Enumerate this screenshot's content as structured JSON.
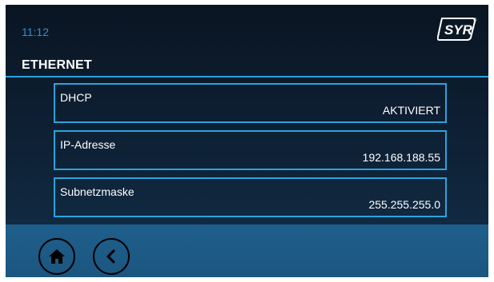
{
  "status": {
    "time": "11:12"
  },
  "brand": {
    "logo_text": "SYR",
    "registered_mark": "®"
  },
  "page": {
    "title": "ETHERNET"
  },
  "settings": [
    {
      "label": "DHCP",
      "value": "AKTIVIERT"
    },
    {
      "label": "IP-Adresse",
      "value": "192.168.188.55"
    },
    {
      "label": "Subnetzmaske",
      "value": "255.255.255.0"
    }
  ],
  "footer": {
    "home_icon": "home-icon",
    "back_icon": "chevron-left-icon"
  },
  "colors": {
    "accent": "#2ca3dc",
    "clock": "#2f8fd4",
    "background": "#0e2237",
    "footer": "#1f5f8c"
  }
}
